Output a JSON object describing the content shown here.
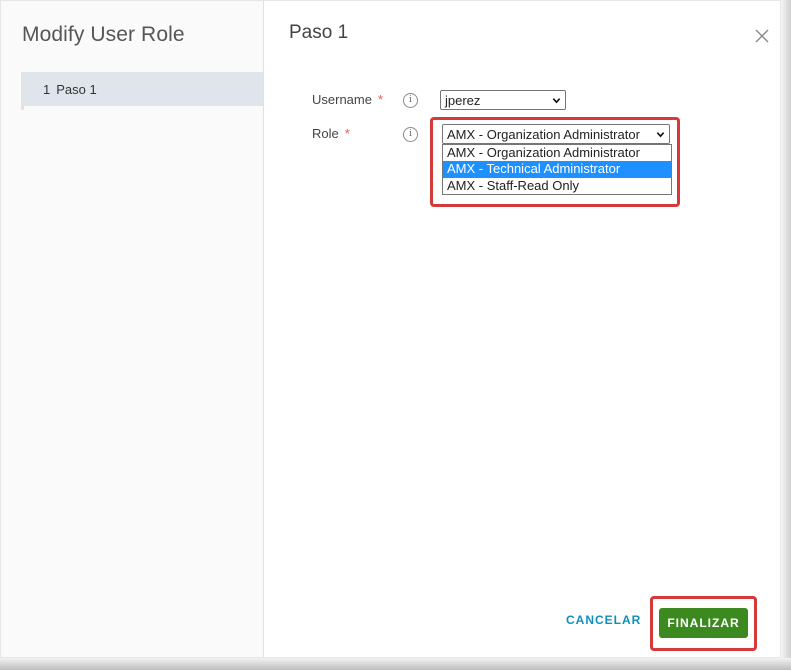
{
  "dialog": {
    "title": "Modify User Role",
    "steps": [
      {
        "number": "1",
        "label": "Paso 1"
      }
    ]
  },
  "step": {
    "title": "Paso 1"
  },
  "form": {
    "username": {
      "label": "Username",
      "required_mark": "*",
      "value": "jperez"
    },
    "role": {
      "label": "Role",
      "required_mark": "*",
      "value": "AMX - Organization Administrator",
      "options": [
        "AMX - Organization Administrator",
        "AMX - Technical Administrator",
        "AMX - Staff-Read Only"
      ],
      "highlighted_option_index": 1
    },
    "info_icon_glyph": "i"
  },
  "footer": {
    "cancel_label": "CANCELAR",
    "finish_label": "FINALIZAR"
  },
  "colors": {
    "highlight_outline": "#d33a3a",
    "primary_button": "#3c8a1f",
    "link": "#0f8fbf",
    "selected_option": "#1e90ff"
  }
}
